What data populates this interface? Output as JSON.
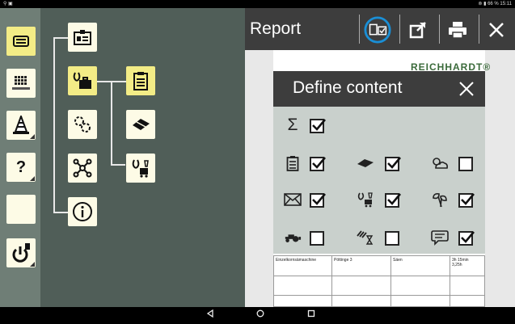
{
  "statusbar": {
    "left": "⚲ ▣",
    "right": "⊚ ▮ 66 % 15:11"
  },
  "report": {
    "title": "Report"
  },
  "doc": {
    "logo": "REICHHARDT®"
  },
  "dialog": {
    "title": "Define content",
    "items": [
      {
        "icon": "sum-icon",
        "checked": true
      },
      {
        "icon": "clipboard-list-icon",
        "checked": true
      },
      {
        "icon": "field-icon",
        "checked": true
      },
      {
        "icon": "weather-icon",
        "checked": false
      },
      {
        "icon": "mail-icon",
        "checked": true
      },
      {
        "icon": "crop-treatment-icon",
        "checked": true
      },
      {
        "icon": "plant-icon",
        "checked": true
      },
      {
        "icon": "tractor-icon",
        "checked": false
      },
      {
        "icon": "time-field-icon",
        "checked": false
      },
      {
        "icon": "comment-icon",
        "checked": true
      }
    ]
  },
  "table": {
    "rows": [
      [
        "Einzelkornsämaschine",
        "Pöttinge 3",
        "Säen",
        "3h 15min\n3,25h"
      ]
    ]
  },
  "sidebar": {
    "items": [
      "report-button",
      "reichhardt-button",
      "cone-button",
      "help-button",
      "empty-button",
      "power-button"
    ]
  },
  "colors": {
    "accent": "#f3ec86",
    "tile": "#fdfbe6",
    "sidebar": "#6f7e76",
    "tree": "#505e58",
    "header": "#3d3d3d"
  }
}
